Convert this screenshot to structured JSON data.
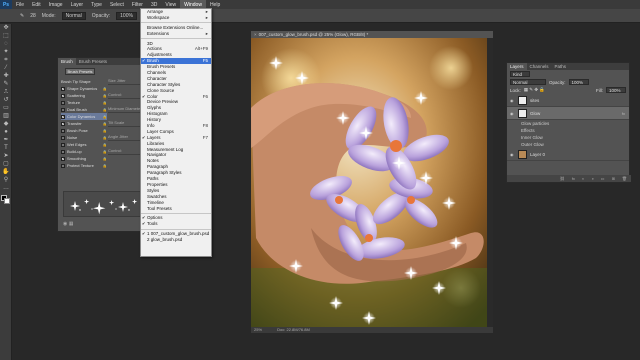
{
  "menubar": {
    "logo": "Ps",
    "items": [
      "File",
      "Edit",
      "Image",
      "Layer",
      "Type",
      "Select",
      "Filter",
      "3D",
      "View",
      "Window",
      "Help"
    ],
    "active": "Window"
  },
  "options": {
    "mode_label": "Mode:",
    "mode_value": "Normal",
    "opacity_label": "Opacity:",
    "opacity_value": "100%",
    "brush_size": "28"
  },
  "document": {
    "tab_title": "007_custom_glow_brush.psd @ 25% (Glow), RGB/8) *",
    "zoom": "25%",
    "doc_info": "Doc: 22.8M/76.8M"
  },
  "brush_panel": {
    "tabs": [
      "Brush",
      "Brush Presets"
    ],
    "presets_button": "Brush Presets",
    "items": [
      {
        "label": "Brush Tip Shape",
        "cb": false,
        "check": false
      },
      {
        "label": "Shape Dynamics",
        "cb": true,
        "check": true
      },
      {
        "label": "Scattering",
        "cb": true,
        "check": true
      },
      {
        "label": "Texture",
        "cb": true,
        "check": false
      },
      {
        "label": "Dual Brush",
        "cb": true,
        "check": false
      },
      {
        "label": "Color Dynamics",
        "cb": true,
        "check": true
      },
      {
        "label": "Transfer",
        "cb": true,
        "check": true
      },
      {
        "label": "Brush Pose",
        "cb": true,
        "check": false
      },
      {
        "label": "Noise",
        "cb": true,
        "check": false
      },
      {
        "label": "Wet Edges",
        "cb": true,
        "check": false
      },
      {
        "label": "Build-up",
        "cb": true,
        "check": false
      },
      {
        "label": "Smoothing",
        "cb": true,
        "check": true
      },
      {
        "label": "Protect Texture",
        "cb": true,
        "check": false
      }
    ],
    "side_fields": [
      "Size Jitter",
      "Control:",
      "Minimum Diameter",
      "Tilt Scale",
      "Angle Jitter",
      "Control:"
    ]
  },
  "window_menu": {
    "groups": [
      [
        {
          "label": "Arrange",
          "sc": "▸"
        },
        {
          "label": "Workspace",
          "sc": "▸"
        }
      ],
      [
        {
          "label": "Browse Extensions Online..."
        },
        {
          "label": "Extensions",
          "sc": "▸"
        }
      ],
      [
        {
          "label": "3D"
        },
        {
          "label": "Actions",
          "sc": "Alt+F9"
        },
        {
          "label": "Adjustments"
        },
        {
          "label": "Brush",
          "sc": "F5",
          "check": true,
          "hl": true
        },
        {
          "label": "Brush Presets"
        },
        {
          "label": "Channels"
        },
        {
          "label": "Character"
        },
        {
          "label": "Character Styles"
        },
        {
          "label": "Clone Source"
        },
        {
          "label": "Color",
          "sc": "F6",
          "check": true
        },
        {
          "label": "Device Preview"
        },
        {
          "label": "Glyphs"
        },
        {
          "label": "Histogram"
        },
        {
          "label": "History"
        },
        {
          "label": "Info",
          "sc": "F8"
        },
        {
          "label": "Layer Comps"
        },
        {
          "label": "Layers",
          "sc": "F7",
          "check": true
        },
        {
          "label": "Libraries"
        },
        {
          "label": "Measurement Log"
        },
        {
          "label": "Navigator"
        },
        {
          "label": "Notes"
        },
        {
          "label": "Paragraph"
        },
        {
          "label": "Paragraph Styles"
        },
        {
          "label": "Paths"
        },
        {
          "label": "Properties"
        },
        {
          "label": "Styles"
        },
        {
          "label": "Swatches"
        },
        {
          "label": "Timeline"
        },
        {
          "label": "Tool Presets"
        }
      ],
      [
        {
          "label": "Options",
          "check": true
        },
        {
          "label": "Tools",
          "check": true
        }
      ],
      [
        {
          "label": "1 007_custom_glow_brush.psd",
          "check": true
        },
        {
          "label": "2 glow_brush.psd"
        }
      ]
    ]
  },
  "layers_panel": {
    "tabs": [
      "Layers",
      "Channels",
      "Paths"
    ],
    "filter_label": "Kind",
    "blend_mode": "Normal",
    "opacity_label": "Opacity:",
    "opacity_value": "100%",
    "lock_label": "Lock:",
    "fill_label": "Fill:",
    "fill_value": "100%",
    "layers": [
      {
        "name": "sites",
        "sel": false,
        "fx": false
      },
      {
        "name": "Glow",
        "sel": true,
        "fx": true
      },
      {
        "name": "Glow particles",
        "sub": true
      },
      {
        "name": "Effects",
        "sub": true
      },
      {
        "name": "Inner Glow",
        "sub": true
      },
      {
        "name": "Outer Glow",
        "sub": true
      },
      {
        "name": "Layer 0",
        "sel": false,
        "fx": false
      }
    ]
  }
}
